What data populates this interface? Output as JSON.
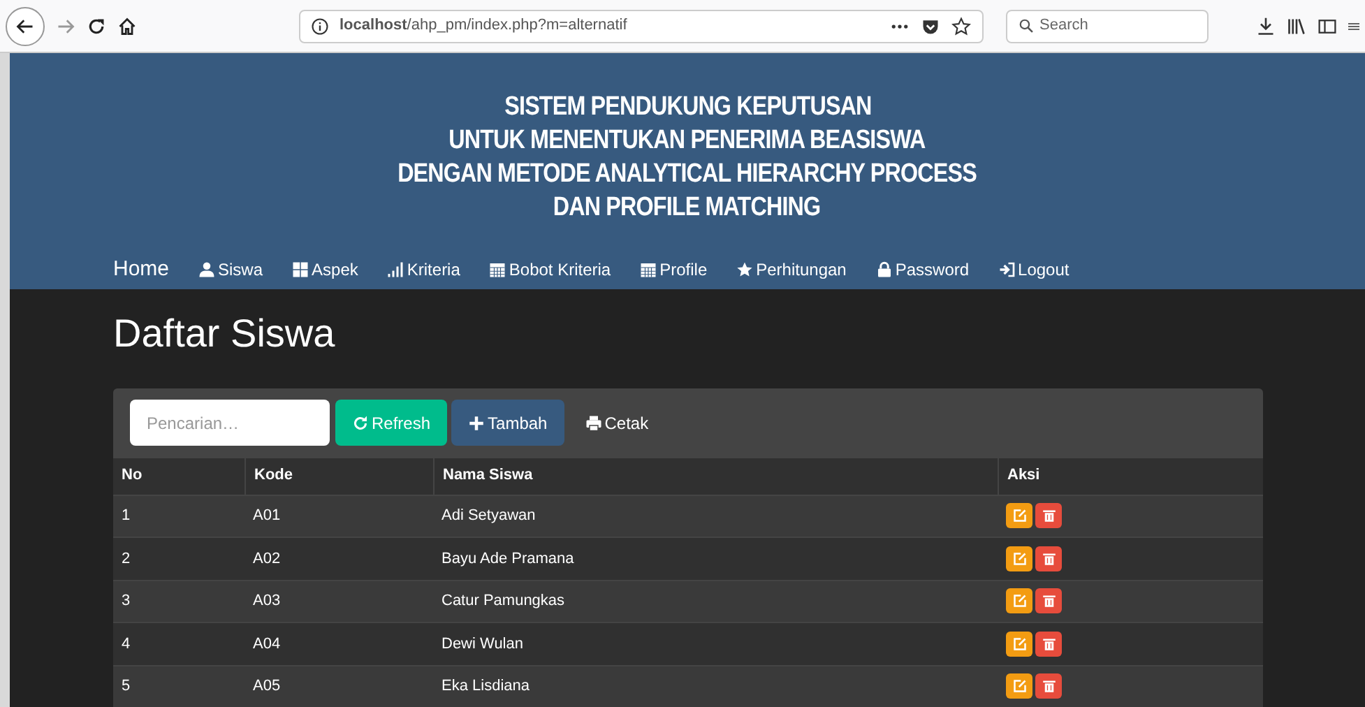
{
  "browser": {
    "url": "**localhost**/ahp_pm/index.php?m=alternatif",
    "search_placeholder": "Search"
  },
  "header": {
    "title_lines": [
      "SISTEM PENDUKUNG KEPUTUSAN",
      "UNTUK MENENTUKAN PENERIMA BEASISWA",
      "DENGAN METODE ANALYTICAL HIERARCHY PROCESS",
      "DAN PROFILE MATCHING"
    ]
  },
  "nav": {
    "brand": "Home",
    "items": [
      {
        "label": "Siswa",
        "kind": "user"
      },
      {
        "label": "Aspek",
        "kind": "grid"
      },
      {
        "label": "Kriteria",
        "kind": "bars"
      },
      {
        "label": "Bobot Kriteria",
        "kind": "calendar"
      },
      {
        "label": "Profile",
        "kind": "calendar"
      },
      {
        "label": "Perhitungan",
        "kind": "star"
      },
      {
        "label": "Password",
        "kind": "lock"
      },
      {
        "label": "Logout",
        "kind": "login"
      }
    ]
  },
  "page_title": "Daftar Siswa",
  "toolbar": {
    "search_placeholder": "Pencarian…",
    "buttons": [
      {
        "label": "Refresh",
        "kind": "refresh"
      },
      {
        "label": "Tambah",
        "kind": "add"
      },
      {
        "label": "Cetak",
        "kind": "print"
      }
    ]
  },
  "table": {
    "columns": [
      "No",
      "Kode",
      "Nama Siswa",
      "Aksi"
    ],
    "rows": [
      [
        "1",
        "A01",
        "Adi Setyawan"
      ],
      [
        "2",
        "A02",
        "Bayu Ade Pramana"
      ],
      [
        "3",
        "A03",
        "Catur Pamungkas"
      ],
      [
        "4",
        "A04",
        "Dewi Wulan"
      ],
      [
        "5",
        "A05",
        "Eka Lisdiana"
      ]
    ]
  }
}
